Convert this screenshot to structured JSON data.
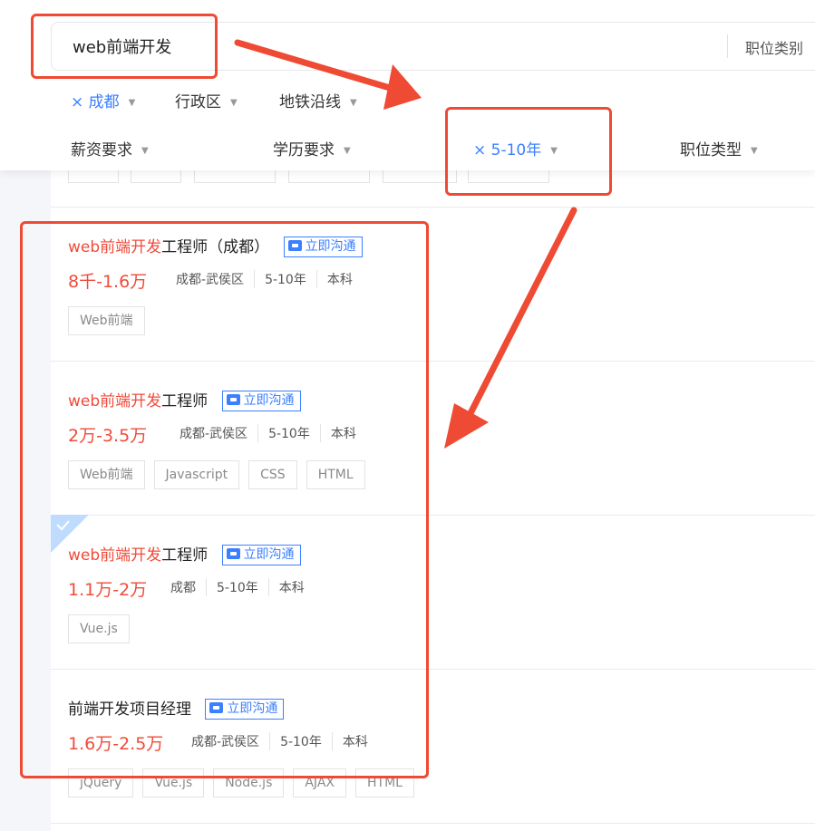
{
  "search": {
    "query": "web前端开发",
    "category_label": "职位类别"
  },
  "filters": {
    "row1": [
      {
        "label": "× 成都",
        "active": true
      },
      {
        "label": "行政区",
        "active": false
      },
      {
        "label": "地铁沿线",
        "active": false
      }
    ],
    "row2": [
      {
        "label": "薪资要求",
        "active": false
      },
      {
        "label": "学历要求",
        "active": false
      },
      {
        "label": "× 5-10年",
        "active": true
      },
      {
        "label": "职位类型",
        "active": false
      }
    ]
  },
  "chat_button_label": "立即沟通",
  "jobs": [
    {
      "title_keyword": "web前端开发",
      "title_rest": "工程师（成都）",
      "salary": "8千-1.6万",
      "location": "成都-武侯区",
      "experience": "5-10年",
      "education": "本科",
      "tags": [
        "Web前端"
      ]
    },
    {
      "title_keyword": "web前端开发",
      "title_rest": "工程师",
      "salary": "2万-3.5万",
      "location": "成都-武侯区",
      "experience": "5-10年",
      "education": "本科",
      "tags": [
        "Web前端",
        "Javascript",
        "CSS",
        "HTML"
      ]
    },
    {
      "title_keyword": "web前端开发",
      "title_rest": "工程师",
      "salary": "1.1万-2万",
      "location": "成都",
      "experience": "5-10年",
      "education": "本科",
      "tags": [
        "Vue.js"
      ],
      "checked": true
    },
    {
      "title_keyword": "",
      "title_rest": "前端开发项目经理",
      "salary": "1.6万-2.5万",
      "location": "成都-武侯区",
      "experience": "5-10年",
      "education": "本科",
      "tags": [
        "jQuery",
        "Vue.js",
        "Node.js",
        "AJAX",
        "HTML"
      ]
    }
  ],
  "colors": {
    "accent": "#3b80ff",
    "keyword": "#f04b3a",
    "annotation": "#ef4a33"
  },
  "icons": [
    "chat-icon",
    "chevron-down-icon",
    "checkmark-icon",
    "close-icon"
  ]
}
